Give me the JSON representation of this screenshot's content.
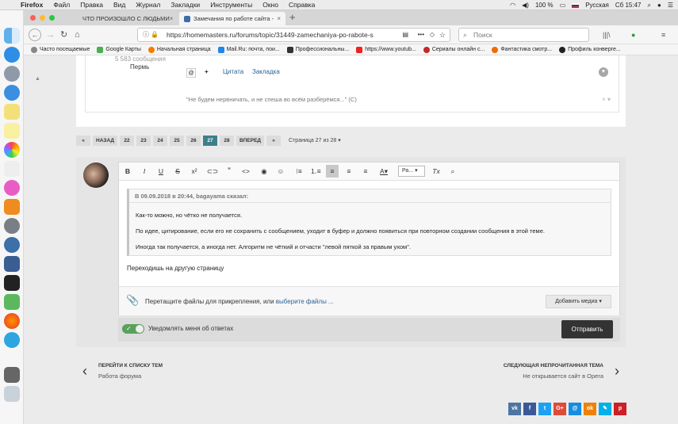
{
  "menubar": {
    "app": "Firefox",
    "items": [
      "Файл",
      "Правка",
      "Вид",
      "Журнал",
      "Закладки",
      "Инструменты",
      "Окно",
      "Справка"
    ],
    "battery": "100 %",
    "language": "Русская",
    "clock": "Сб 15:47"
  },
  "tabs": [
    {
      "title": "ЧТО ПРОИЗОШЛО С ЛЮДЬМИ"
    },
    {
      "title": "Замечания по работе сайта -"
    }
  ],
  "navbar": {
    "url": "https://homemasters.ru/forums/topic/31449-zamechaniya-po-rabote-s",
    "search_placeholder": "Поиск"
  },
  "bookmarks": [
    "Часто посещаемые",
    "Google Карты",
    "Начальная страница",
    "Mail.Ru: почта, пои...",
    "Профессиональны...",
    "https://www.youtub...",
    "Сериалы онлайн с...",
    "Фантастика смотр...",
    "Профиль конверге..."
  ],
  "post": {
    "message_count": "5 583 сообщения",
    "location": "Пермь",
    "quote_action": "Цитата",
    "bookmark_action": "Закладка",
    "signature": "\"Не будем нервничать, и не спеша во всём разберёмся...\" (С)"
  },
  "pagination": {
    "prev": "НАЗАД",
    "pages": [
      "22",
      "23",
      "24",
      "25",
      "26",
      "27",
      "28"
    ],
    "current": "27",
    "next": "ВПЕРЕД",
    "info": "Страница 27 из 28"
  },
  "editor": {
    "font_select": "Ра...",
    "quote_header": "В 09.09.2018 в 20:44, bagayama сказал:",
    "quote_lines": [
      "Как-то можно, но чётко не получается.",
      "По идее, цитирование, если его не сохранить с сообщением, уходит в буфер и должно появиться при повторном создании сообщения в этой теме.",
      "Иногда так получается, а иногда нет. Алгоритм не чёткий и отчасти \"левой пяткой за правым ухом\"."
    ],
    "reply_text": "Переходишь на другую страницу",
    "attach_text": "Перетащите файлы для прикрепления, или",
    "attach_link": "выберите файлы ...",
    "media_button": "Добавить медиа",
    "notify_label": "Уведомлять меня об ответах",
    "submit": "Отправить"
  },
  "bottom_nav": {
    "back_title": "ПЕРЕЙТИ К СПИСКУ ТЕМ",
    "back_sub": "Работа форума",
    "next_title": "СЛЕДУЮЩАЯ НЕПРОЧИТАННАЯ ТЕМА",
    "next_sub": "Не открывается сайт в Opera"
  },
  "social": [
    "vk",
    "f",
    "t",
    "G+",
    "@",
    "ok",
    "✎",
    "p"
  ],
  "colors": {
    "accent": "#3f7f8c",
    "link": "#2a6496",
    "submit_bg": "#333333"
  }
}
